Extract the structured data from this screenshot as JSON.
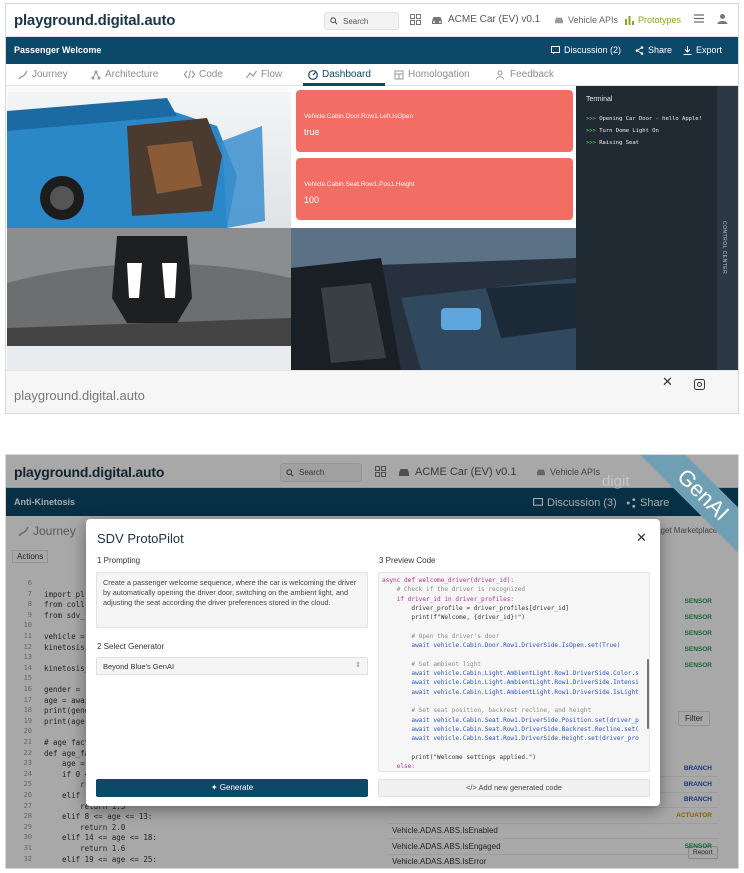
{
  "colors": {
    "primary": "#0c4868",
    "accent_red": "#f26d63",
    "terminal_bg": "#1f2a32",
    "prototypes_green": "#8aa32b"
  },
  "shot1": {
    "brand": "playground.digital.auto",
    "search_placeholder": "Search",
    "car_model": "ACME Car (EV) v0.1",
    "vehicle_apis": "Vehicle APIs",
    "prototypes": "Prototypes",
    "prototype_name": "Passenger Welcome",
    "discussion": "Discussion (2)",
    "share": "Share",
    "export": "Export",
    "tabs": [
      "Journey",
      "Architecture",
      "Code",
      "Flow",
      "Dashboard",
      "Homologation",
      "Feedback"
    ],
    "active_tab": "Dashboard",
    "signals": [
      {
        "api": "Vehicle.Cabin.Door.Row1.Left.IsOpen",
        "value": "true"
      },
      {
        "api": "Vehicle.Cabin.Seat.Row1.Pos1.Height",
        "value": "100"
      }
    ],
    "terminal": {
      "title": "Terminal",
      "prompt": ">>>",
      "lines": [
        "Opening Car Door - hello Apple!",
        "Turn Dome Light On",
        "Raising Seat"
      ]
    },
    "control_center_label": "CONTROL CENTER",
    "footer_brand": "playground.digital.auto"
  },
  "shot2": {
    "brand": "playground.digital.auto",
    "search_placeholder": "Search",
    "car_model": "ACME Car (EV) v0.1",
    "vehicle_apis": "Vehicle APIs",
    "prototype_name": "Anti-Kinetosis",
    "discussion": "Discussion (3)",
    "share": "Share",
    "journey_tab": "Journey",
    "actions_label": "Actions",
    "widget_marketplace": "dget Marketplace >",
    "filter_label": "Filter",
    "genai_ribbon": "GenAI",
    "watermark": "digit",
    "report_label": "Report",
    "code_lines": [
      {
        "n": "6",
        "t": ""
      },
      {
        "n": "7",
        "t": "import pl"
      },
      {
        "n": "8",
        "t": "from coll"
      },
      {
        "n": "9",
        "t": "from sdv_"
      },
      {
        "n": "10",
        "t": ""
      },
      {
        "n": "11",
        "t": "vehicle ="
      },
      {
        "n": "12",
        "t": "kinetosis_"
      },
      {
        "n": "13",
        "t": ""
      },
      {
        "n": "14",
        "t": "kinetosis_"
      },
      {
        "n": "15",
        "t": ""
      },
      {
        "n": "16",
        "t": "gender = "
      },
      {
        "n": "17",
        "t": "age = awai"
      },
      {
        "n": "18",
        "t": "print(gend"
      },
      {
        "n": "19",
        "t": "print(age)"
      },
      {
        "n": "20",
        "t": ""
      },
      {
        "n": "21",
        "t": "# age fact"
      },
      {
        "n": "22",
        "t": "def age_fa"
      },
      {
        "n": "23",
        "t": "    age ="
      },
      {
        "n": "24",
        "t": "    if 0 <"
      },
      {
        "n": "25",
        "t": "        r"
      },
      {
        "n": "26",
        "t": "    elif"
      },
      {
        "n": "27",
        "t": "        return 1.5"
      },
      {
        "n": "28",
        "t": "    elif 8 <= age <= 13:"
      },
      {
        "n": "29",
        "t": "        return 2.0"
      },
      {
        "n": "30",
        "t": "    elif 14 <= age <= 18:"
      },
      {
        "n": "31",
        "t": "        return 1.6"
      },
      {
        "n": "32",
        "t": "    elif 19 <= age <= 25:"
      }
    ],
    "right_panel_types_top": [
      "SENSOR",
      "SENSOR",
      "SENSOR",
      "SENSOR",
      "SENSOR"
    ],
    "right_panel_rows": [
      {
        "name": "",
        "type": "BRANCH"
      },
      {
        "name": "",
        "type": "BRANCH"
      },
      {
        "name": "",
        "type": "BRANCH"
      },
      {
        "name": "",
        "type": "ACTUATOR"
      },
      {
        "name": "Vehicle.ADAS.ABS.IsEnabled",
        "type": ""
      },
      {
        "name": "Vehicle.ADAS.ABS.IsEngaged",
        "type": "SENSOR"
      },
      {
        "name": "Vehicle.ADAS.ABS.IsError",
        "type": ""
      }
    ],
    "modal": {
      "title": "SDV ProtoPilot",
      "step1": "1  Prompting",
      "prompt_text": "Create a passenger welcome sequence, where the car is welcoming the driver by automatically opening the driver door, switching on the ambient light, and adjusting the seat according the driver preferences stored in the cloud.",
      "step2": "2  Select Generator",
      "generator": "Beyond Blue's GenAI",
      "generate_button": "Generate",
      "step3": "3  Preview Code",
      "add_code_button": "Add new generated code",
      "preview_code": [
        "async def welcome_driver(driver_id):",
        "    # Check if the driver is recognized",
        "    if driver_id in driver_profiles:",
        "        driver_profile = driver_profiles[driver_id]",
        "        print(f\"Welcome, {driver_id}!\")",
        "",
        "        # Open the driver's door",
        "        await vehicle.Cabin.Door.Row1.DriverSide.IsOpen.set(True)",
        "",
        "        # Set ambient light",
        "        await vehicle.Cabin.Light.AmbientLight.Row1.DriverSide.Color.s",
        "        await vehicle.Cabin.Light.AmbientLight.Row1.DriverSide.Intensi",
        "        await vehicle.Cabin.Light.AmbientLight.Row1.DriverSide.IsLight",
        "",
        "        # Set seat position, backrest recline, and height",
        "        await vehicle.Cabin.Seat.Row1.DriverSide.Position.set(driver_p",
        "        await vehicle.Cabin.Seat.Row1.DriverSide.Backrest.Recline.set(",
        "        await vehicle.Cabin.Seat.Row1.DriverSide.Height.set(driver_pro",
        "",
        "        print(\"Welcome settings applied.\")",
        "    else:"
      ]
    }
  }
}
